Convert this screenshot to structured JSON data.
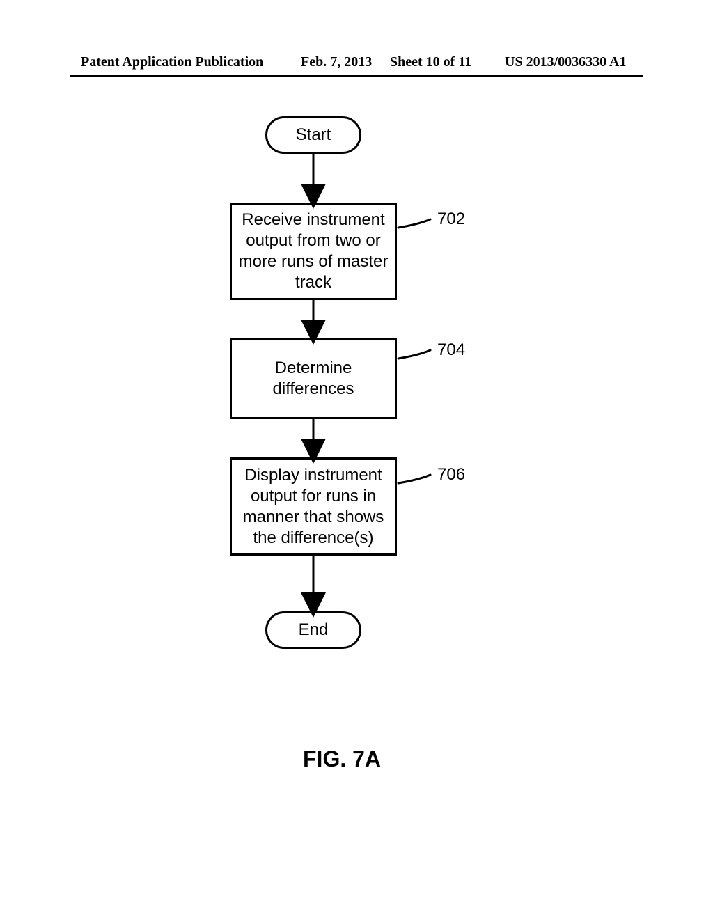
{
  "header": {
    "publication": "Patent Application Publication",
    "date": "Feb. 7, 2013",
    "sheet": "Sheet 10 of 11",
    "docnum": "US 2013/0036330 A1"
  },
  "flowchart": {
    "start": "Start",
    "end": "End",
    "steps": [
      {
        "id": "702",
        "text": "Receive instrument output from two or more runs of master track"
      },
      {
        "id": "704",
        "text": "Determine differences"
      },
      {
        "id": "706",
        "text": "Display instrument output for runs in manner that shows the difference(s)"
      }
    ]
  },
  "figure_label": "FIG. 7A"
}
